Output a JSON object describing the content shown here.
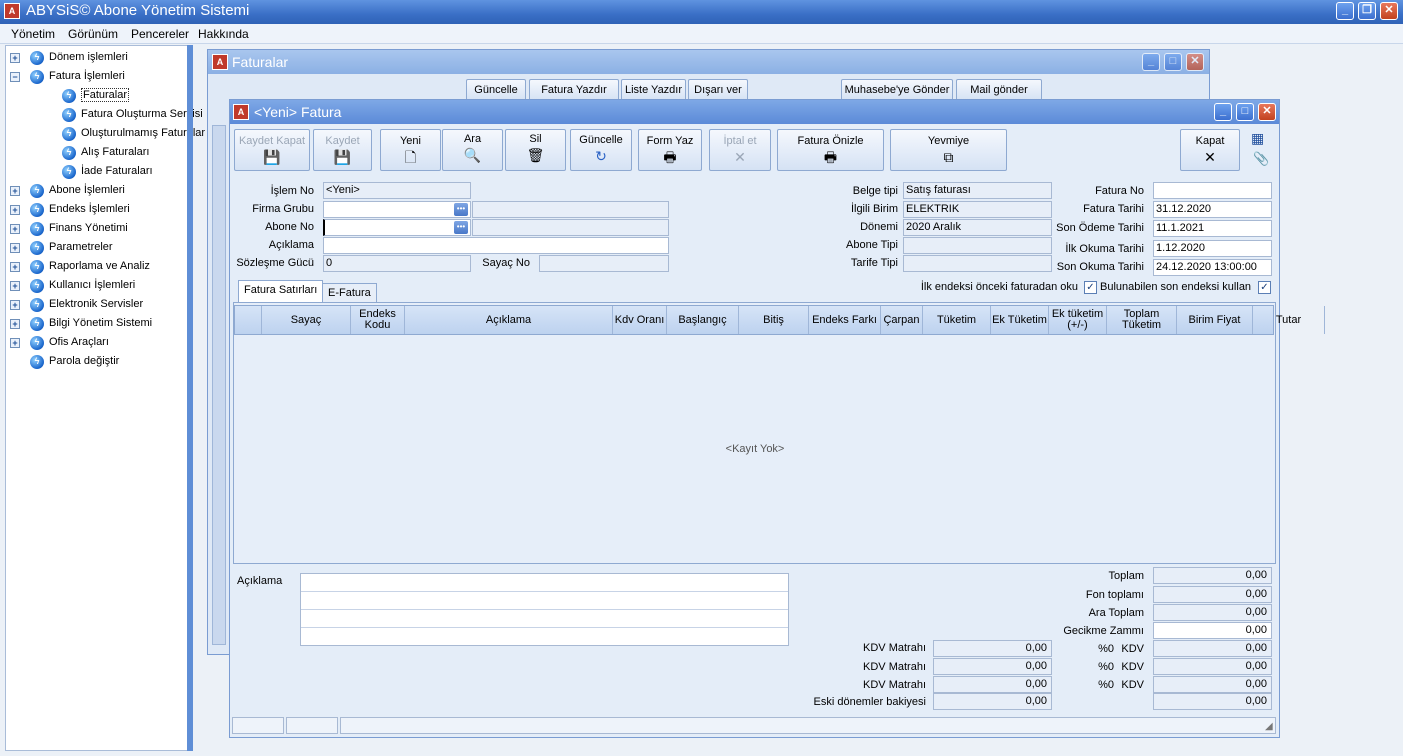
{
  "app": {
    "title": "ABYSiS© Abone Yönetim Sistemi",
    "icon": "app-logo-icon",
    "window_buttons": [
      "_",
      "❐",
      "✕"
    ]
  },
  "menu": [
    "Yönetim",
    "Görünüm",
    "Pencereler",
    "Hakkında"
  ],
  "tree": [
    {
      "label": "Dönem işlemleri",
      "level": 0,
      "expander": "+"
    },
    {
      "label": "Fatura İşlemleri",
      "level": 0,
      "expander": "−"
    },
    {
      "label": "Faturalar",
      "level": 1,
      "selected": true
    },
    {
      "label": "Fatura Oluşturma Servisi",
      "level": 1
    },
    {
      "label": "Oluşturulmamış Faturalar",
      "level": 1
    },
    {
      "label": "Alış Faturaları",
      "level": 1
    },
    {
      "label": "İade Faturaları",
      "level": 1
    },
    {
      "label": "Abone İşlemleri",
      "level": 0,
      "expander": "+"
    },
    {
      "label": "Endeks İşlemleri",
      "level": 0,
      "expander": "+"
    },
    {
      "label": "Finans Yönetimi",
      "level": 0,
      "expander": "+"
    },
    {
      "label": "Parametreler",
      "level": 0,
      "expander": "+"
    },
    {
      "label": "Raporlama ve Analiz",
      "level": 0,
      "expander": "+"
    },
    {
      "label": "Kullanıcı İşlemleri",
      "level": 0,
      "expander": "+"
    },
    {
      "label": "Elektronik Servisler",
      "level": 0,
      "expander": "+"
    },
    {
      "label": "Bilgi Yönetim Sistemi",
      "level": 0,
      "expander": "+"
    },
    {
      "label": "Ofis Araçları",
      "level": 0,
      "expander": "+"
    },
    {
      "label": "Parola değiştir",
      "level": 0
    }
  ],
  "faturalar": {
    "title": "Faturalar",
    "buttons": [
      "Güncelle",
      "Fatura Yazdır",
      "Liste Yazdır",
      "Dışarı ver",
      "Muhasebe'ye Gönder",
      "Mail gönder"
    ]
  },
  "fatura": {
    "title": "<Yeni> Fatura",
    "toolbar": {
      "kaydet_kapat": "Kaydet Kapat",
      "kaydet": "Kaydet",
      "yeni": "Yeni",
      "ara": "Ara",
      "sil": "Sil",
      "guncelle": "Güncelle",
      "form_yaz": "Form Yaz",
      "iptal": "İptal et",
      "onizle": "Fatura Önizle",
      "yevmiye": "Yevmiye",
      "kapat": "Kapat"
    },
    "left": {
      "islem_no_label": "İşlem No",
      "islem_no": "<Yeni>",
      "firma_grubu_label": "Firma Grubu",
      "firma_grubu": "",
      "abone_no_label": "Abone No",
      "abone_no": "",
      "aciklama_label": "Açıklama",
      "aciklama": "",
      "sozlesme_label": "Sözleşme Gücü",
      "sozlesme": "0",
      "sayac_label": "Sayaç No",
      "sayac": ""
    },
    "mid": {
      "belge_tipi_label": "Belge tipi",
      "belge_tipi": "Satış faturası",
      "ilgili_birim_label": "İlgili Birim",
      "ilgili_birim": "ELEKTRIK",
      "donemi_label": "Dönemi",
      "donemi": "2020 Aralık",
      "abone_tipi_label": "Abone Tipi",
      "abone_tipi": "",
      "tarife_tipi_label": "Tarife Tipi",
      "tarife_tipi": ""
    },
    "right": {
      "fatura_no_label": "Fatura No",
      "fatura_no": "",
      "fatura_tarihi_label": "Fatura Tarihi",
      "fatura_tarihi": "31.12.2020",
      "son_odeme_label": "Son Ödeme Tarihi",
      "son_odeme": "11.1.2021",
      "ilk_okuma_label": "İlk Okuma Tarihi",
      "ilk_okuma": "1.12.2020",
      "son_okuma_label": "Son Okuma Tarihi",
      "son_okuma": "24.12.2020 13:00:00"
    },
    "checks": {
      "ilk_endeks": "İlk endeksi önceki faturadan oku",
      "son_endeks": "Bulunabilen son endeksi kullan"
    },
    "tabs": [
      "Fatura Satırları",
      "E-Fatura"
    ],
    "grid": {
      "columns": [
        "",
        "Sayaç",
        "Endeks Kodu",
        "Açıklama",
        "Kdv Oranı",
        "Başlangıç",
        "Bitiş",
        "Endeks Farkı",
        "Çarpan",
        "Tüketim",
        "Ek Tüketim",
        "Ek tüketim (+/-)",
        "Toplam Tüketim",
        "Birim Fiyat",
        "Tutar"
      ],
      "empty": "<Kayıt Yok>"
    },
    "bottom": {
      "aciklama_label": "Açıklama",
      "kdv_matrahi_label": "KDV Matrahı",
      "kdv_matrahlari": [
        "0,00",
        "0,00",
        "0,00"
      ],
      "eski_label": "Eski dönemler bakiyesi",
      "eski": "0,00",
      "toplam_label": "Toplam",
      "toplam": "0,00",
      "fon_label": "Fon toplamı",
      "fon": "0,00",
      "ara_label": "Ara Toplam",
      "ara": "0,00",
      "gecikme_label": "Gecikme Zammı",
      "gecikme": "0,00",
      "kdv_rows": [
        {
          "oran": "%0",
          "label": "KDV",
          "value": "0,00"
        },
        {
          "oran": "%0",
          "label": "KDV",
          "value": "0,00"
        },
        {
          "oran": "%0",
          "label": "KDV",
          "value": "0,00"
        }
      ],
      "genel": "0,00"
    }
  }
}
